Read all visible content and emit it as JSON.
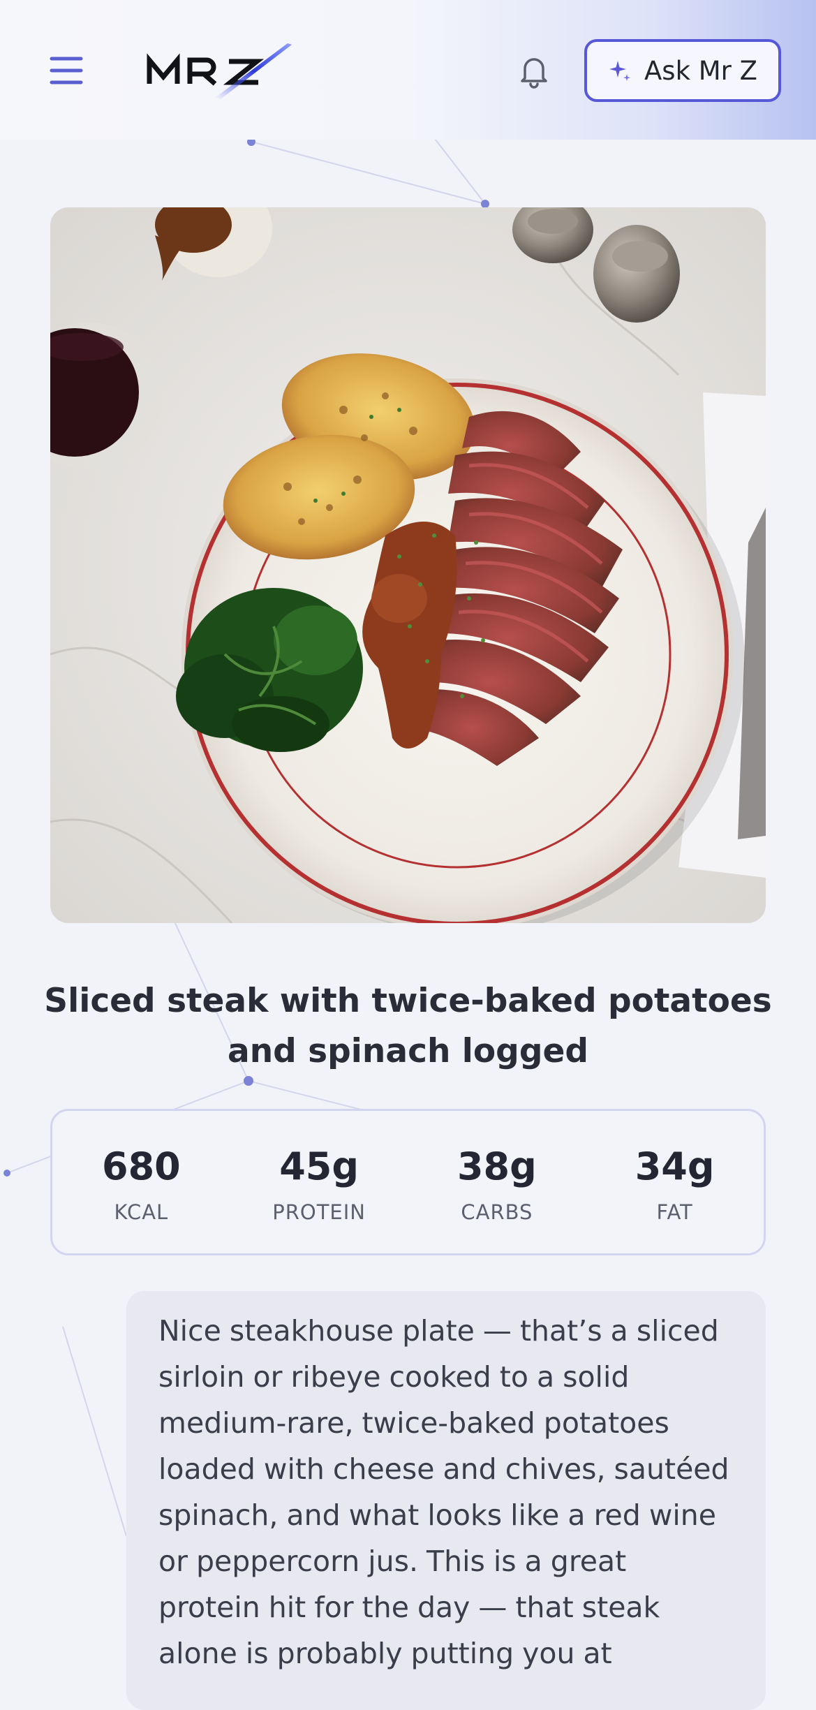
{
  "header": {
    "logo_text": "MRZ",
    "ask_button_label": "Ask Mr Z",
    "icons": {
      "menu": "hamburger-menu-icon",
      "notifications": "bell-icon",
      "ask": "sparkle-icon"
    }
  },
  "meal": {
    "photo_alt": "Sliced steak with twice-baked potatoes and spinach",
    "title": "Sliced steak with twice-baked potatoes and spinach logged",
    "macros": [
      {
        "value": "680",
        "label": "KCAL"
      },
      {
        "value": "45g",
        "label": "PROTEIN"
      },
      {
        "value": "38g",
        "label": "CARBS"
      },
      {
        "value": "34g",
        "label": "FAT"
      }
    ]
  },
  "assistant_message": "Nice steakhouse plate — that’s a sliced sirloin or ribeye cooked to a solid medium-rare, twice-baked potatoes loaded with cheese and chives, sautéed spinach, and what looks like a red wine or peppercorn jus. This is a great protein hit for the day — that steak alone is probably putting you at",
  "colors": {
    "accent": "#5658d8",
    "background": "#f2f3f9",
    "bubble": "#e8e9f0",
    "card_border": "#d3d4f0"
  }
}
